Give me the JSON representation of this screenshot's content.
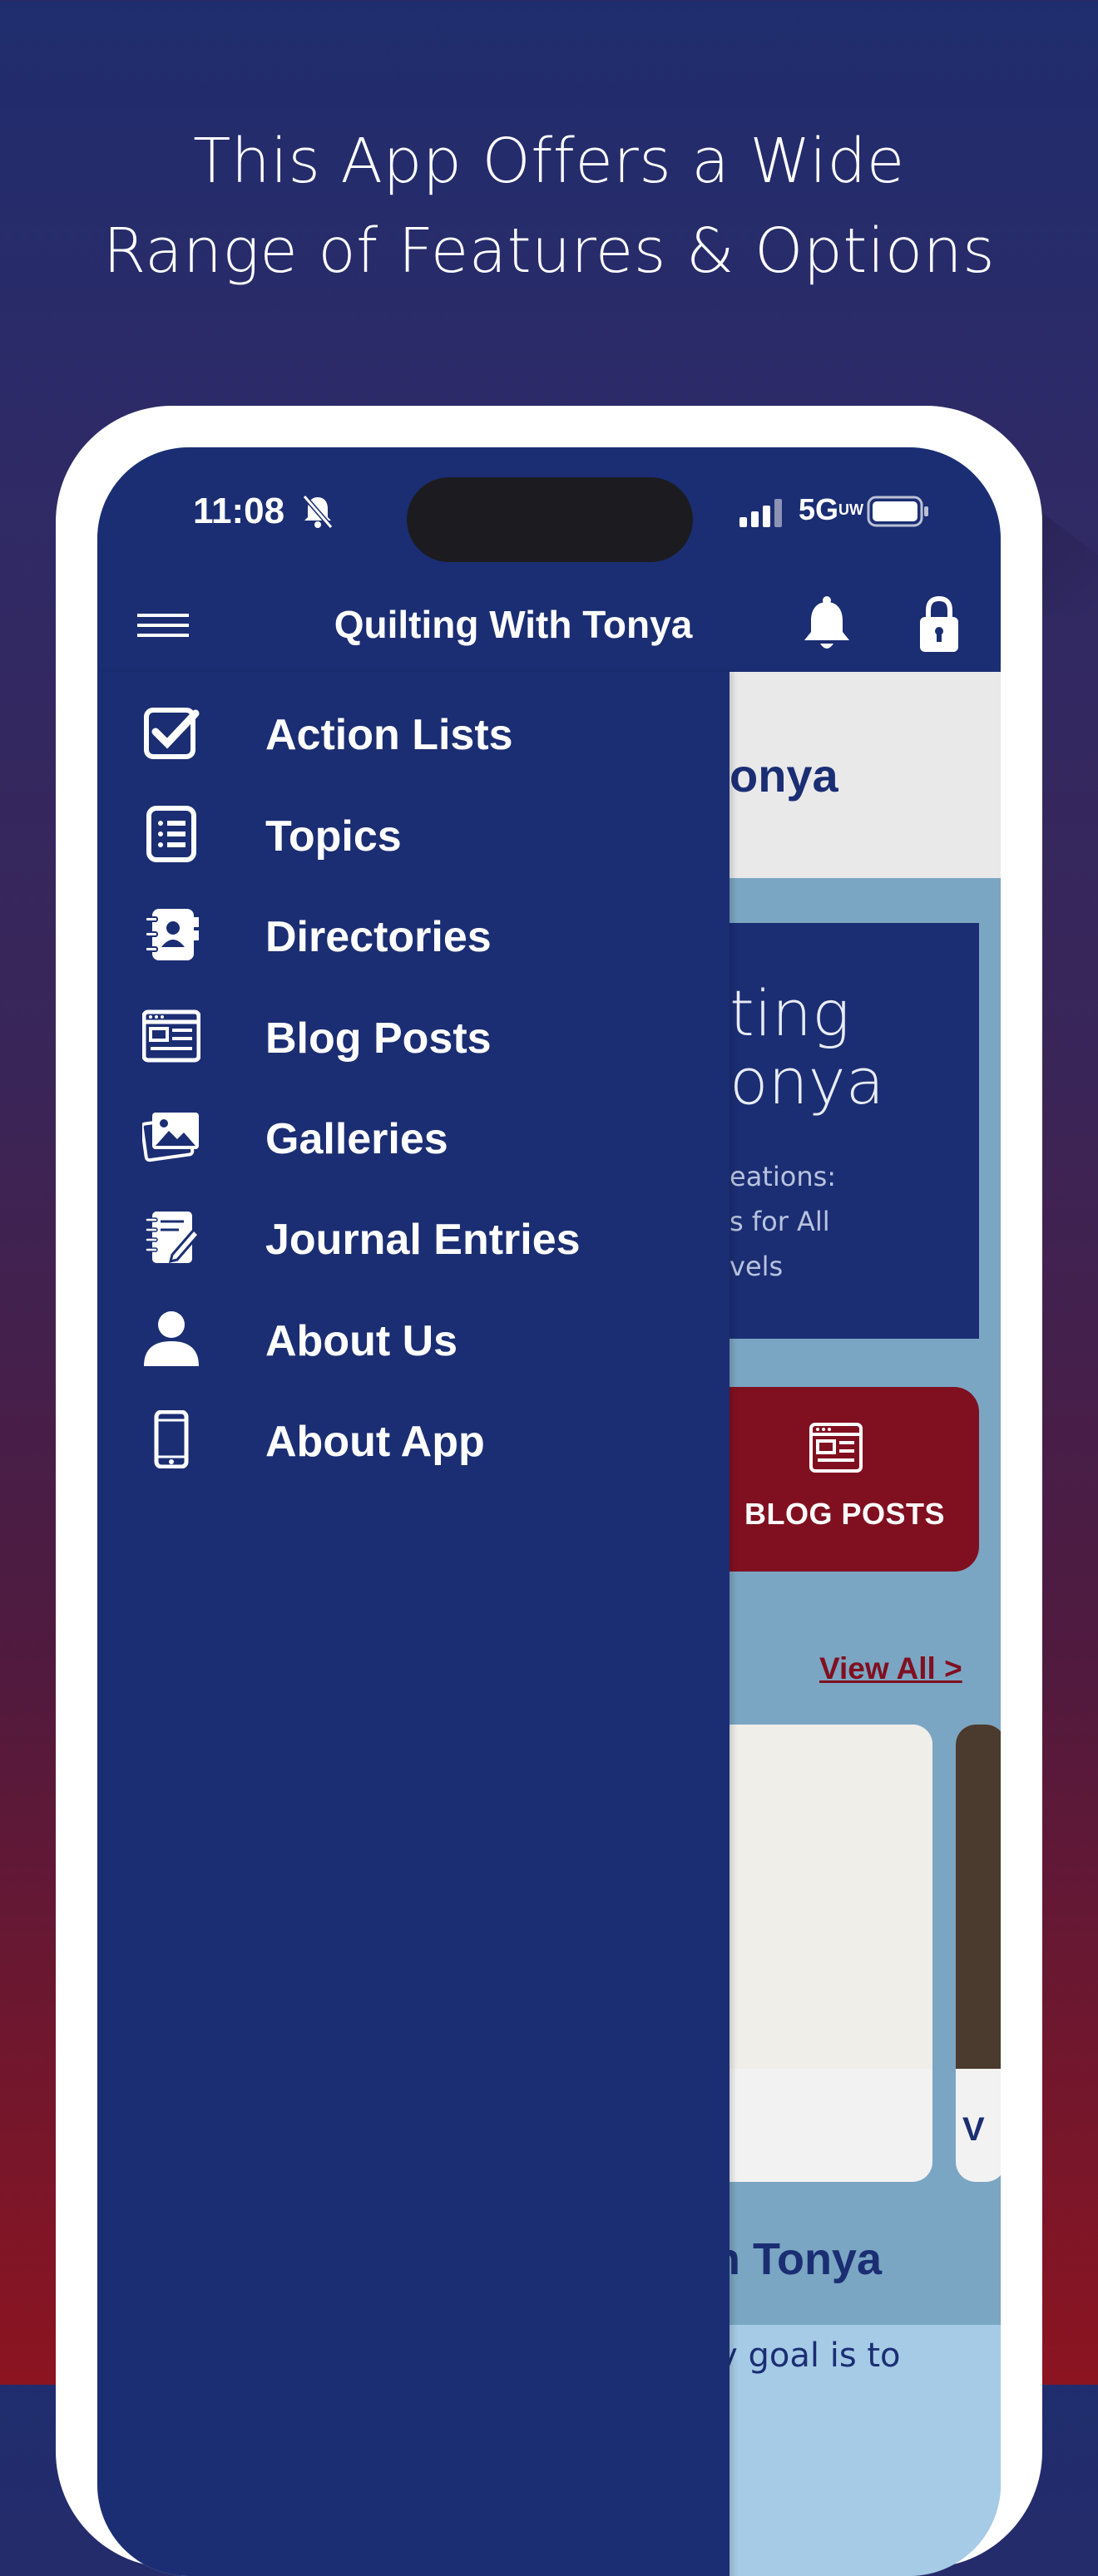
{
  "headline": {
    "line1": "This App Offers a Wide",
    "line2": "Range of Features & Options"
  },
  "status_bar": {
    "time": "11:08",
    "network": "5G",
    "network_sub": "UW"
  },
  "app_bar": {
    "title": "Quilting With Tonya"
  },
  "drawer": {
    "items": [
      {
        "label": "Action Lists",
        "icon": "checkbox-icon"
      },
      {
        "label": "Topics",
        "icon": "list-icon"
      },
      {
        "label": "Directories",
        "icon": "contact-book-icon"
      },
      {
        "label": "Blog Posts",
        "icon": "newspaper-icon"
      },
      {
        "label": "Galleries",
        "icon": "gallery-icon"
      },
      {
        "label": "Journal Entries",
        "icon": "journal-icon"
      },
      {
        "label": "About Us",
        "icon": "user-icon"
      },
      {
        "label": "About App",
        "icon": "phone-icon"
      }
    ]
  },
  "background": {
    "header_partial": "onya",
    "banner_title_line1": "ting",
    "banner_title_line2": "onya",
    "banner_sub_line1": "eations:",
    "banner_sub_line2": "s for All",
    "banner_sub_line3": "vels",
    "blog_posts_label": "BLOG POSTS",
    "view_all": "View All  >",
    "card2_letter": "V",
    "footer_title": "h Tonya",
    "footer_text": "ly goal is to"
  },
  "colors": {
    "drawer_bg": "#1b2e73",
    "accent": "#801020",
    "content_bg": "#7aa6c3"
  }
}
